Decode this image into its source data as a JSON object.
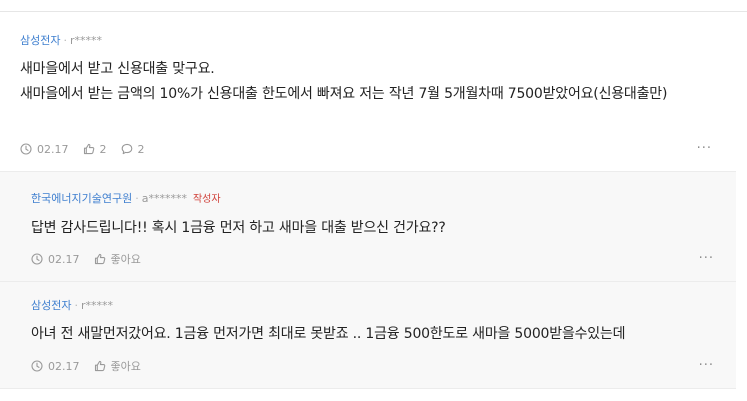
{
  "comments": [
    {
      "company": "삼성전자",
      "author": "r*****",
      "lines": [
        "새마을에서 받고 신용대출 맞구요.",
        "새마을에서 받는 금액의 10%가 신용대출 한도에서 빠져요 저는 작년 7월 5개월차때 7500받았어요(신용대출만)"
      ],
      "date": "02.17",
      "likes": "2",
      "replies": "2",
      "more": "···"
    },
    {
      "company": "한국에너지기술연구원",
      "author": "a*******",
      "author_tag": "작성자",
      "text": "답변 감사드립니다!! 혹시 1금융 먼저 하고 새마을 대출 받으신 건가요??",
      "date": "02.17",
      "like_label": "좋아요",
      "more": "···"
    },
    {
      "company": "삼성전자",
      "author": "r*****",
      "text": "아녀 전 새말먼저갔어요. 1금융 먼저가면 최대로 못받죠 .. 1금융 500한도로 새마을 5000받을수있는데",
      "date": "02.17",
      "like_label": "좋아요",
      "more": "···"
    }
  ],
  "icons": {
    "clock": "clock-icon",
    "thumb": "thumbs-up-icon",
    "reply": "speech-bubble-icon",
    "more": "more-dots-icon"
  },
  "colors": {
    "company": "#3f7fcf",
    "author_tag": "#d0423b",
    "reply_bg": "#f8f8f8"
  }
}
